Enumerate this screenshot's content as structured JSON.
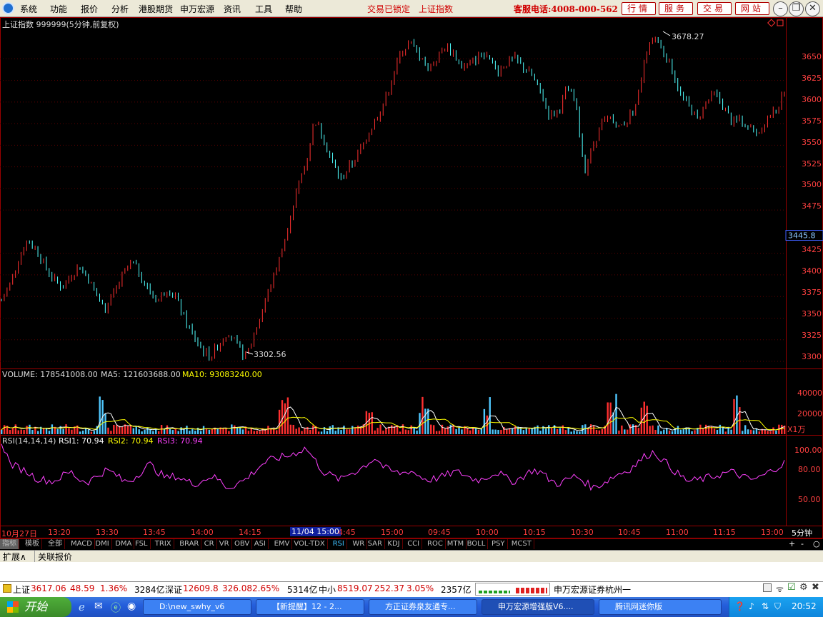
{
  "menu": {
    "items": [
      "系统",
      "功能",
      "报价",
      "分析",
      "港股期货",
      "申万宏源",
      "资讯",
      "工具",
      "帮助"
    ],
    "lock_status": "交易已锁定",
    "current_index": "上证指数",
    "hotline": "客服电话:4008-000-562",
    "buttons": [
      "行情",
      "服务",
      "交易",
      "网站"
    ]
  },
  "chart": {
    "title": "上证指数 999999(5分钟,前复权)",
    "high_label": "3678.27",
    "low_label": "3302.56",
    "current_price_label": "3445.8",
    "y_ticks": [
      "3650",
      "3625",
      "3600",
      "3575",
      "3550",
      "3525",
      "3500",
      "3475",
      "3425",
      "3400",
      "3375",
      "3350",
      "3325",
      "3300"
    ],
    "volume_label": "VOLUME: 178541008.00",
    "ma5_label": "MA5: 121603688.00",
    "ma10_label": "MA10: 93083240.00",
    "volume_ticks": [
      "40000",
      "20000"
    ],
    "volume_unit": "X1万",
    "rsi_label": "RSI(14,14,14)",
    "rsi1_label": "RSI1: 70.94",
    "rsi2_label": "RSI2: 70.94",
    "rsi3_label": "RSI3: 70.94",
    "rsi_ticks": [
      "100.00",
      "80.00",
      "50.00"
    ],
    "time_labels": [
      "10月27日",
      "13:20",
      "13:30",
      "13:45",
      "14:00",
      "14:15",
      "11/04 15:00",
      "4:45",
      "15:00",
      "09:45",
      "10:00",
      "10:15",
      "10:30",
      "10:45",
      "11:00",
      "11:15",
      "13:00"
    ],
    "period": "5分钟"
  },
  "indicator_tabs": [
    "指标",
    "模板",
    "全部",
    "MACD",
    "DMI",
    "DMA",
    "FSL",
    "TRIX",
    "BRAR",
    "CR",
    "VR",
    "OBV",
    "ASI",
    "EMV",
    "VOL-TDX",
    "RSI",
    "WR",
    "SAR",
    "KDJ",
    "CCI",
    "ROC",
    "MTM",
    "BOLL",
    "PSY",
    "MCST"
  ],
  "status_bar": {
    "expand": "扩展∧",
    "related": "关联报价"
  },
  "ticker": {
    "sh_name": "上证",
    "sh_value": "3617.06",
    "sh_change": "48.59",
    "sh_pct": "1.36%",
    "sh_amount": "3284亿",
    "sz_name": "深证",
    "sz_value": "12609.8",
    "sz_change": "326.08",
    "sz_pct": "2.65%",
    "sz_amount": "5314亿",
    "zx_name": "中小",
    "zx_value": "8519.07",
    "zx_change": "252.37",
    "zx_pct": "3.05%",
    "zx_amount": "2357亿",
    "broker": "申万宏源证券杭州一"
  },
  "taskbar": {
    "start": "开始",
    "tasks": [
      "D:\\new_swhy_v6",
      "【新提醒】12 - 2...",
      "方正证券泉友通专...",
      "申万宏源增强版V6....",
      "腾讯网迷你版"
    ],
    "clock": "20:52"
  },
  "colors": {
    "up": "#ff3030",
    "down": "#50ffff",
    "ma5": "#ffffff",
    "ma10": "#ffff00",
    "rsi": "#ff40ff",
    "grid": "#800000"
  },
  "chart_data": {
    "type": "line",
    "title": "上证指数 999999(5分钟,前复权)",
    "ylim": [
      3295,
      3690
    ],
    "series": [
      {
        "name": "上证指数",
        "values": [
          3370,
          3390,
          3420,
          3440,
          3430,
          3410,
          3395,
          3385,
          3400,
          3410,
          3395,
          3375,
          3360,
          3380,
          3400,
          3415,
          3400,
          3380,
          3370,
          3385,
          3375,
          3350,
          3330,
          3315,
          3305,
          3320,
          3335,
          3320,
          3303,
          3330,
          3360,
          3390,
          3420,
          3460,
          3500,
          3530,
          3580,
          3560,
          3530,
          3510,
          3525,
          3540,
          3560,
          3580,
          3600,
          3630,
          3660,
          3668,
          3655,
          3640,
          3650,
          3665,
          3655,
          3640,
          3645,
          3655,
          3650,
          3635,
          3645,
          3650,
          3640,
          3630,
          3610,
          3585,
          3590,
          3615,
          3600,
          3520,
          3550,
          3575,
          3580,
          3570,
          3580,
          3600,
          3650,
          3678,
          3660,
          3640,
          3610,
          3595,
          3580,
          3600,
          3610,
          3595,
          3575,
          3580,
          3570,
          3565,
          3580,
          3590,
          3610
        ]
      },
      {
        "name": "RSI1",
        "values": [
          98,
          70,
          65,
          60,
          52,
          50,
          48,
          55,
          60,
          50,
          48,
          55,
          62,
          58,
          48,
          50,
          60,
          70,
          60,
          52,
          55,
          50,
          45,
          48,
          55,
          50,
          40,
          45,
          50,
          60,
          70,
          75,
          78,
          80,
          85,
          90,
          75,
          60,
          55,
          50,
          58,
          62,
          70,
          78,
          65,
          60,
          58,
          62,
          55,
          50,
          52,
          55,
          60,
          58,
          52,
          50,
          55,
          60,
          52,
          48,
          55,
          62,
          60,
          50,
          45,
          50,
          55,
          48,
          40,
          45,
          52,
          58,
          62,
          70,
          80,
          85,
          75,
          65,
          55,
          48,
          50,
          52,
          55,
          58,
          60,
          55,
          50,
          52,
          58,
          65,
          71
        ]
      }
    ]
  }
}
